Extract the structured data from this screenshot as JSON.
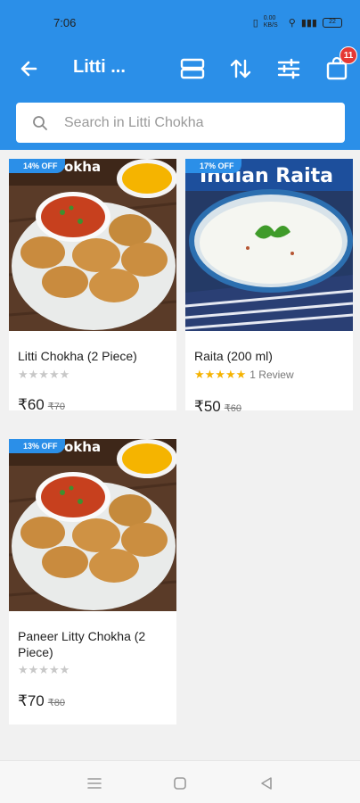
{
  "status_bar": {
    "time": "7:06",
    "net_speed": "0.00 KB/S",
    "battery": "22"
  },
  "app_bar": {
    "title": "Litti ...",
    "cart_count": "11",
    "icons": [
      "back-arrow-icon",
      "view-toggle-icon",
      "sort-icon",
      "filter-icon",
      "cart-icon"
    ]
  },
  "search": {
    "placeholder": "Search in Litti Chokha"
  },
  "products": [
    {
      "name": "Litti Chokha (2 Piece)",
      "discount": "14% OFF",
      "price": "₹60",
      "mrp": "₹70",
      "rating": 0,
      "reviews": "",
      "image_caption": "okha"
    },
    {
      "name": "Raita (200 ml)",
      "discount": "17% OFF",
      "price": "₹50",
      "mrp": "₹60",
      "rating": 5,
      "reviews": "1 Review",
      "image_caption": "Indian Raita"
    },
    {
      "name": "Paneer Litty Chokha (2 Piece)",
      "discount": "13% OFF",
      "price": "₹70",
      "mrp": "₹80",
      "rating": 0,
      "reviews": "",
      "image_caption": "okha"
    }
  ],
  "colors": {
    "primary": "#2b8fe8",
    "badge_red": "#e53935",
    "star_filled": "#f5b301",
    "star_empty": "#c8c8c8"
  },
  "nav_bar": {
    "icons": [
      "menu-icon",
      "home-square-icon",
      "back-triangle-icon"
    ]
  }
}
